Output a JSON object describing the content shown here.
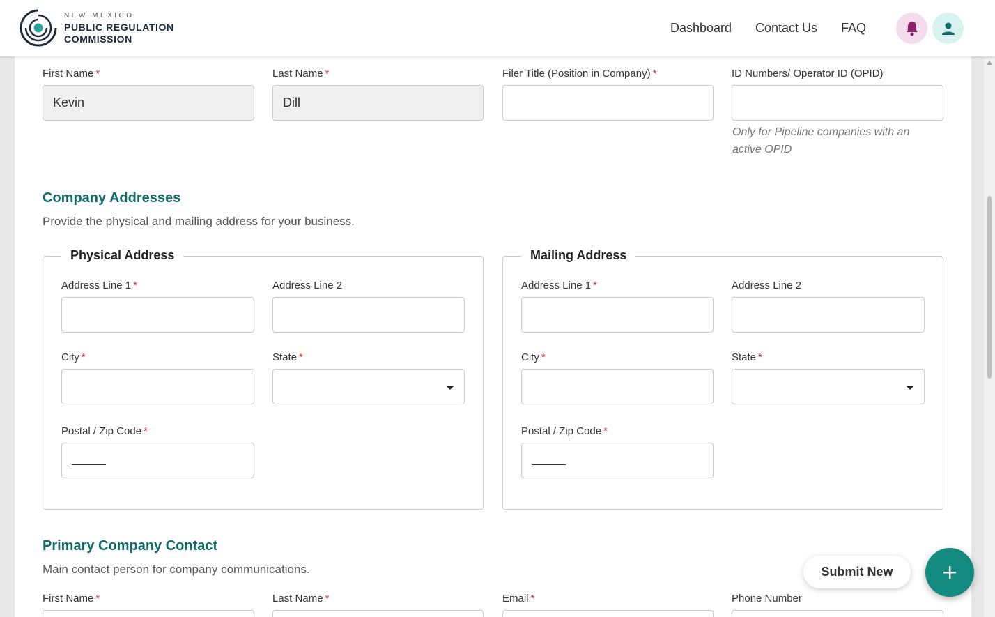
{
  "brand": {
    "line1": "NEW MEXICO",
    "line2": "PUBLIC REGULATION",
    "line3": "COMMISSION",
    "colors": {
      "teal": "#138a80",
      "dark_navy": "#1e2a38"
    },
    "logo_icon": "swirl-logo-icon"
  },
  "nav": {
    "dashboard": "Dashboard",
    "contact_us": "Contact Us",
    "faq": "FAQ",
    "bell_icon": "bell-icon",
    "user_icon": "user-icon"
  },
  "filer": {
    "first_name_label": "First Name",
    "first_name_value": "Kevin",
    "last_name_label": "Last Name",
    "last_name_value": "Dill",
    "title_label": "Filer Title (Position in Company)",
    "title_value": "",
    "opid_label": "ID Numbers/ Operator ID (OPID)",
    "opid_value": "",
    "opid_hint": "Only for Pipeline companies with an active OPID"
  },
  "required_marker": "*",
  "addresses": {
    "title": "Company Addresses",
    "subtitle": "Provide the physical and mailing address for your business.",
    "physical": {
      "legend": "Physical Address",
      "line1_label": "Address Line 1",
      "line1_value": "",
      "line2_label": "Address Line 2",
      "line2_value": "",
      "city_label": "City",
      "city_value": "",
      "state_label": "State",
      "state_value": "",
      "zip_label": "Postal / Zip Code",
      "zip_value": ""
    },
    "mailing": {
      "legend": "Mailing Address",
      "line1_label": "Address Line 1",
      "line1_value": "",
      "line2_label": "Address Line 2",
      "line2_value": "",
      "city_label": "City",
      "city_value": "",
      "state_label": "State",
      "state_value": "",
      "zip_label": "Postal / Zip Code",
      "zip_value": ""
    }
  },
  "contact": {
    "title": "Primary Company Contact",
    "subtitle": "Main contact person for company communications.",
    "first_name_label": "First Name",
    "last_name_label": "Last Name",
    "email_label": "Email",
    "phone_label": "Phone Number"
  },
  "fab": {
    "submit_label": "Submit New",
    "plus_icon": "plus-icon"
  }
}
